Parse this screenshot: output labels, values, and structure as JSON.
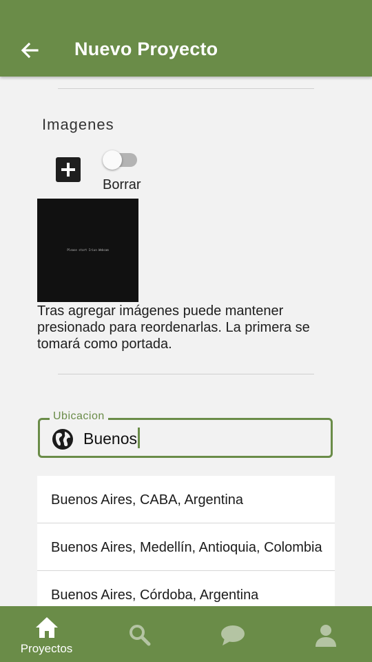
{
  "header": {
    "title": "Nuevo Proyecto",
    "back_icon": "arrow-back-icon"
  },
  "images_section": {
    "title": "Imagenes",
    "add_icon": "add-box-icon",
    "toggle_label": "Borrar",
    "toggle_on": false,
    "thumbnail_caption": "Please start Iriun Webcam",
    "help_text": "Tras agregar imágenes puede mantener presionado para reordenarlas. La primera se tomará como portada."
  },
  "location": {
    "label": "Ubicacion",
    "icon": "globe-icon",
    "value": "Buenos",
    "suggestions": [
      "Buenos Aires, CABA, Argentina",
      "Buenos Aires, Medellín, Antioquia, Colombia",
      "Buenos Aires, Córdoba, Argentina"
    ]
  },
  "bottom_nav": [
    {
      "label": "Proyectos",
      "icon": "home-icon",
      "active": true
    },
    {
      "label": "",
      "icon": "search-icon",
      "active": false
    },
    {
      "label": "",
      "icon": "chat-icon",
      "active": false
    },
    {
      "label": "",
      "icon": "person-icon",
      "active": false
    }
  ],
  "colors": {
    "primary": "#6a8c48",
    "background": "#f2f2f2",
    "inactive_icon": "#b4c4a3"
  }
}
